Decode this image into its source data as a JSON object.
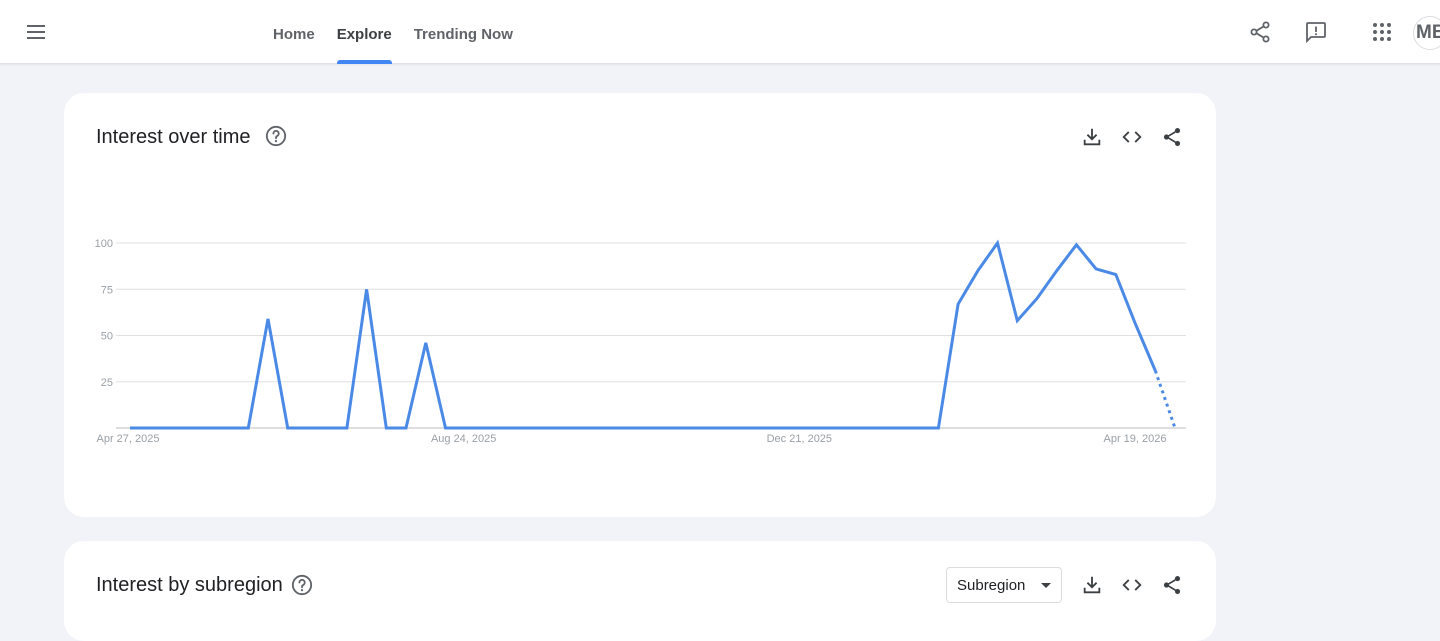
{
  "header": {
    "tabs": [
      {
        "label": "Home",
        "active": false
      },
      {
        "label": "Explore",
        "active": true
      },
      {
        "label": "Trending Now",
        "active": false
      }
    ],
    "avatar_initials": "ME"
  },
  "colors": {
    "accent": "#4285f4",
    "line": "#4a8ae6",
    "gridline": "#e0e0e0",
    "axis_label": "#9aa0a6"
  },
  "interest_over_time": {
    "title": "Interest over time",
    "chart_data": {
      "type": "line",
      "x_tick_labels": [
        "Apr 27, 2025",
        "Aug 24, 2025",
        "Dec 21, 2025",
        "Apr 19, 2026"
      ],
      "y_ticks": [
        25,
        50,
        75,
        100
      ],
      "ylim": [
        0,
        100
      ],
      "grid": true,
      "legend": "none",
      "x_start": "Apr 27, 2025",
      "x_interval": "weekly",
      "series": [
        {
          "values": [
            0,
            0,
            0,
            0,
            0,
            0,
            0,
            59,
            0,
            0,
            0,
            0,
            75,
            0,
            0,
            46,
            0,
            0,
            0,
            0,
            0,
            0,
            0,
            0,
            0,
            0,
            0,
            0,
            0,
            0,
            0,
            0,
            0,
            0,
            0,
            0,
            0,
            0,
            0,
            0,
            0,
            0,
            67,
            85,
            100,
            58,
            70,
            85,
            99,
            86,
            83,
            56,
            31,
            0
          ],
          "partial_from_index": 52
        }
      ]
    }
  },
  "interest_by_subregion": {
    "title": "Interest by subregion",
    "select_value": "Subregion"
  }
}
